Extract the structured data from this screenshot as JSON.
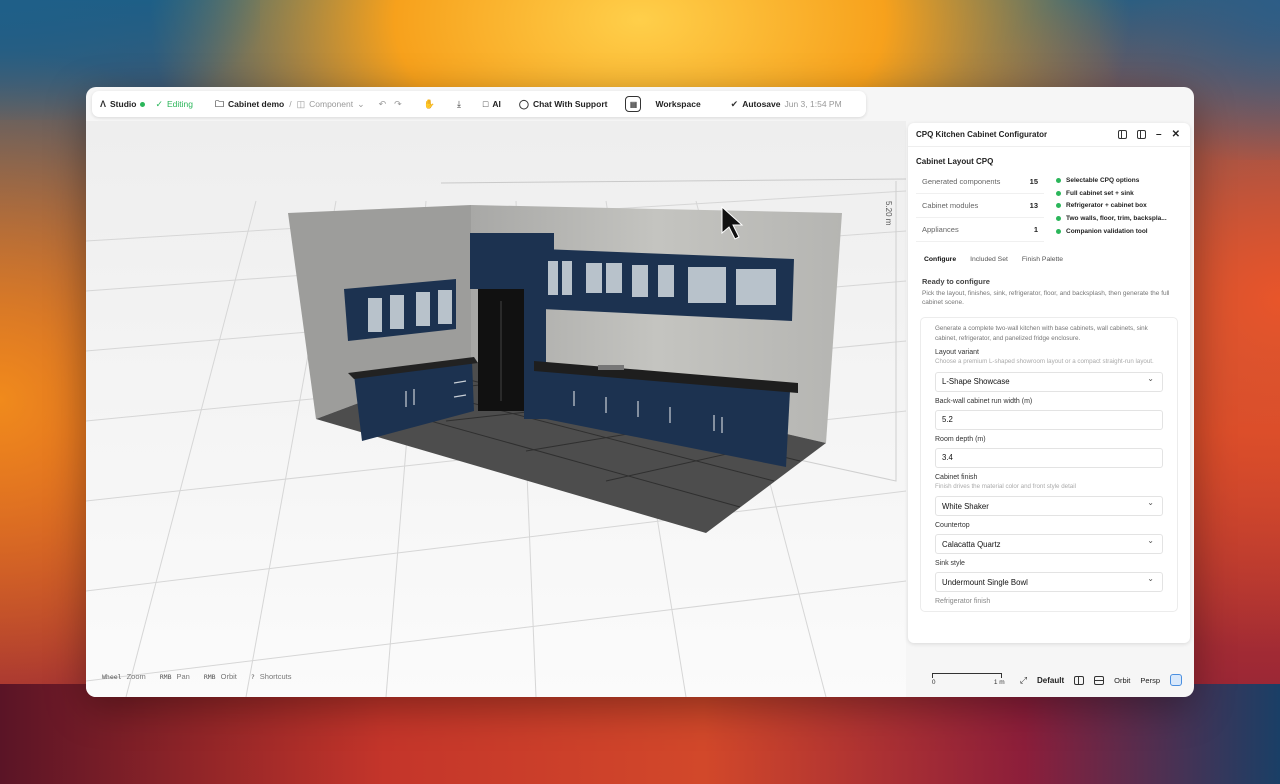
{
  "toolbar": {
    "app": "Studio",
    "status": "Editing",
    "project": "Cabinet demo",
    "component": "Component",
    "ai": "AI",
    "support": "Chat With Support",
    "workspace": "Workspace",
    "autosave_label": "Autosave",
    "autosave_time": "Jun 3, 1:54 PM"
  },
  "viewport": {
    "hints": [
      {
        "key": "Wheel",
        "label": "Zoom"
      },
      {
        "key": "RMB",
        "label": "Pan"
      },
      {
        "key": "RMB",
        "label": "Orbit"
      },
      {
        "key": "?",
        "label": "Shortcuts"
      }
    ],
    "scale_start": "0",
    "scale_end": "1 m",
    "view_preset": "Default",
    "orbit": "Orbit",
    "projection": "Persp",
    "dimension_label": "5.20 m"
  },
  "panel": {
    "title": "CPQ Kitchen Cabinet Configurator",
    "heading": "Cabinet Layout CPQ",
    "stats": [
      {
        "label": "Generated components",
        "value": "15"
      },
      {
        "label": "Cabinet modules",
        "value": "13"
      },
      {
        "label": "Appliances",
        "value": "1"
      }
    ],
    "features": [
      "Selectable CPQ options",
      "Full cabinet set + sink",
      "Refrigerator + cabinet box",
      "Two walls, floor, trim, backspla...",
      "Companion validation tool"
    ],
    "tabs": [
      "Configure",
      "Included Set",
      "Finish Palette"
    ],
    "ready_title": "Ready to configure",
    "ready_sub": "Pick the layout, finishes, sink, refrigerator, floor, and backsplash, then generate the full cabinet scene.",
    "form": {
      "desc": "Generate a complete two-wall kitchen with base cabinets, wall cabinets, sink cabinet, refrigerator, and panelized fridge enclosure.",
      "layout_label": "Layout variant",
      "layout_hint": "Choose a premium L-shaped showroom layout or a compact straight-run layout.",
      "layout_value": "L-Shape Showcase",
      "width_label": "Back-wall cabinet run width (m)",
      "width_value": "5.2",
      "depth_label": "Room depth (m)",
      "depth_value": "3.4",
      "finish_label": "Cabinet finish",
      "finish_hint": "Finish drives the material color and front style detail",
      "finish_value": "White Shaker",
      "counter_label": "Countertop",
      "counter_value": "Calacatta Quartz",
      "sink_label": "Sink style",
      "sink_value": "Undermount Single Bowl",
      "fridge_label": "Refrigerator finish"
    }
  },
  "colors": {
    "cabinet": "#1c3250",
    "accent_green": "#2bb65a",
    "floor": "#4e4e4e",
    "wall": "#b9b9b9"
  }
}
